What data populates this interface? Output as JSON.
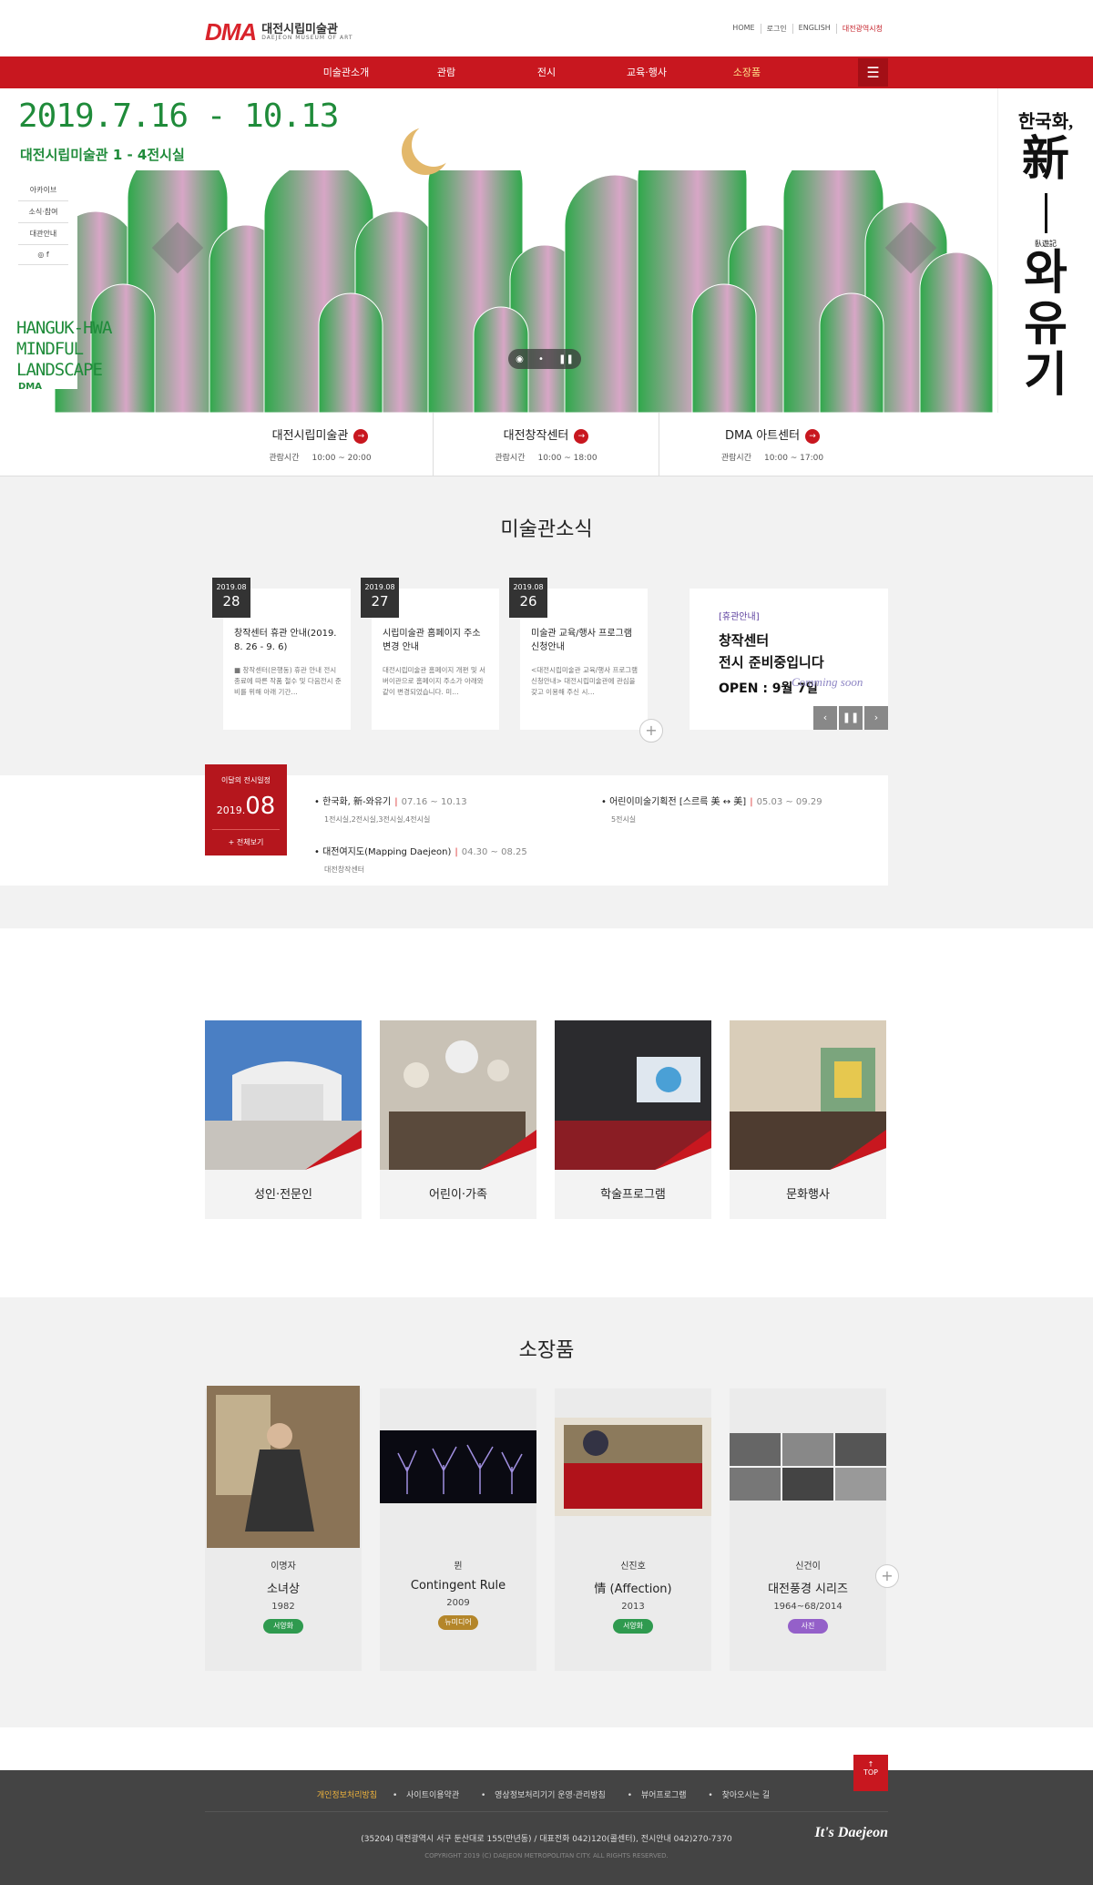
{
  "header": {
    "logo_mark": "DMA",
    "logo_ko": "대전시립미술관",
    "logo_en": "DAEJEON MUSEUM OF ART",
    "util": [
      "HOME",
      "로그인",
      "ENGLISH",
      "대전광역시청"
    ]
  },
  "gnb": {
    "items": [
      "미술관소개",
      "관람",
      "전시",
      "교육·행사",
      "소장품"
    ],
    "active_index": 4,
    "menu_icon": "hamburger-icon"
  },
  "hero": {
    "date": "2019.7.16 - 10.13",
    "place": "대전시립미술관 1 - 4전시실",
    "side_menu": [
      "아카이브",
      "소식·참여",
      "대관안내"
    ],
    "eng_title": [
      "HANGUK-HWA",
      "MINDFUL",
      "LANDSCAPE"
    ],
    "eng_mark": "DMA",
    "vertical_title_1": "한국화,",
    "vertical_title_2": "新",
    "vertical_title_3": "와",
    "vertical_title_4": "유",
    "vertical_title_5": "기",
    "vertical_small": "臥遊記"
  },
  "quick": [
    {
      "name": "대전시립미술관",
      "label": "관람시간",
      "hours": "10:00 ~ 20:00"
    },
    {
      "name": "대전창작센터",
      "label": "관람시간",
      "hours": "10:00 ~ 18:00"
    },
    {
      "name": "DMA 아트센터",
      "label": "관람시간",
      "hours": "10:00 ~ 17:00"
    }
  ],
  "news": {
    "title": "미술관소식",
    "cards": [
      {
        "ym": "2019.08",
        "day": "28",
        "title": "창작센터 휴관 안내(2019. 8. 26 - 9. 6)",
        "body": "■ 창작센터(은행동) 휴관 안내 전시종료에 따른 작품 철수 및 다음전시 준비를 위해 아래 기간…"
      },
      {
        "ym": "2019.08",
        "day": "27",
        "title": "시립미술관 홈페이지 주소 변경 안내",
        "body": "대전시립미술관 홈페이지 개편 및 서버이관으로 홈페이지 주소가 아래와 같이 변경되었습니다. 미…"
      },
      {
        "ym": "2019.08",
        "day": "26",
        "title": "미술관 교육/행사 프로그램 신청안내",
        "body": "<대전시립미술관 교육/행사 프로그램 신청안내> 대전시립미술관에 관심을 갖고 이용해 주신 시…"
      }
    ],
    "notice": {
      "tag": "[휴관안내]",
      "line1": "창작센터",
      "line2": "전시 준비중입니다",
      "open": "OPEN : 9월 7일",
      "script": "Comming soon"
    }
  },
  "schedule": {
    "label": "이달의 전시일정",
    "year": "2019.",
    "month": "08",
    "all": "+ 전체보기",
    "items": [
      {
        "title": "한국화, 新-와유기",
        "period": "07.16 ~ 10.13",
        "place": "1전시실,2전시실,3전시실,4전시실"
      },
      {
        "title": "어린이미술기획전 [스르륵 美 ↔ 美]",
        "period": "05.03 ~ 09.29",
        "place": "5전시실"
      },
      {
        "title": "대전여지도(Mapping Daejeon)",
        "period": "04.30 ~ 08.25",
        "place": "대전창작센터"
      }
    ]
  },
  "programs": [
    {
      "label": "성인·전문인"
    },
    {
      "label": "어린이·가족"
    },
    {
      "label": "학술프로그램"
    },
    {
      "label": "문화행사"
    }
  ],
  "collection": {
    "title": "소장품",
    "items": [
      {
        "artist": "이명자",
        "title": "소녀상",
        "year": "1982",
        "badge": "서양화",
        "color": "#2f9a4f"
      },
      {
        "artist": "뮌",
        "title": "Contingent Rule",
        "year": "2009",
        "badge": "뉴미디어",
        "color": "#b4862a"
      },
      {
        "artist": "신진호",
        "title": "情 (Affection)",
        "year": "2013",
        "badge": "서양화",
        "color": "#2f9a4f"
      },
      {
        "artist": "신건이",
        "title": "대전풍경 시리즈",
        "year": "1964~68/2014",
        "badge": "사진",
        "color": "#9460c9"
      }
    ]
  },
  "footer": {
    "top": "TOP",
    "links": [
      "개인정보처리방침",
      "사이트이용약관",
      "영상정보처리기기 운영·관리방침",
      "뷰어프로그램",
      "찾아오시는 길"
    ],
    "address": "(35204) 대전광역시 서구 둔산대로 155(만년동) / 대표전화 042)120(콜센터), 전시안내 042)270-7370",
    "copyright": "COPYRIGHT 2019 (C) DAEJEON METROPOLITAN CITY. ALL RIGHTS RESERVED.",
    "brand": "It's Daejeon"
  }
}
